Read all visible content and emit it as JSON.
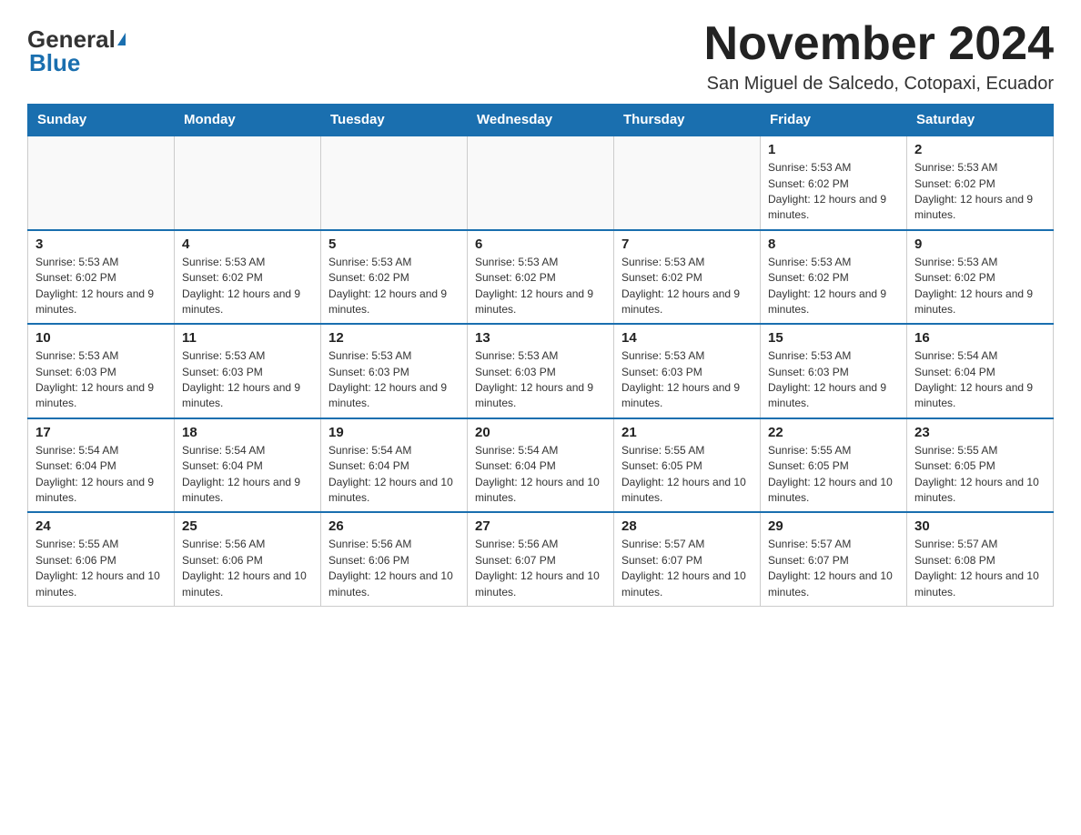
{
  "logo": {
    "general": "General",
    "blue": "Blue"
  },
  "title": "November 2024",
  "subtitle": "San Miguel de Salcedo, Cotopaxi, Ecuador",
  "weekdays": [
    "Sunday",
    "Monday",
    "Tuesday",
    "Wednesday",
    "Thursday",
    "Friday",
    "Saturday"
  ],
  "weeks": [
    [
      {
        "day": "",
        "info": ""
      },
      {
        "day": "",
        "info": ""
      },
      {
        "day": "",
        "info": ""
      },
      {
        "day": "",
        "info": ""
      },
      {
        "day": "",
        "info": ""
      },
      {
        "day": "1",
        "info": "Sunrise: 5:53 AM\nSunset: 6:02 PM\nDaylight: 12 hours and 9 minutes."
      },
      {
        "day": "2",
        "info": "Sunrise: 5:53 AM\nSunset: 6:02 PM\nDaylight: 12 hours and 9 minutes."
      }
    ],
    [
      {
        "day": "3",
        "info": "Sunrise: 5:53 AM\nSunset: 6:02 PM\nDaylight: 12 hours and 9 minutes."
      },
      {
        "day": "4",
        "info": "Sunrise: 5:53 AM\nSunset: 6:02 PM\nDaylight: 12 hours and 9 minutes."
      },
      {
        "day": "5",
        "info": "Sunrise: 5:53 AM\nSunset: 6:02 PM\nDaylight: 12 hours and 9 minutes."
      },
      {
        "day": "6",
        "info": "Sunrise: 5:53 AM\nSunset: 6:02 PM\nDaylight: 12 hours and 9 minutes."
      },
      {
        "day": "7",
        "info": "Sunrise: 5:53 AM\nSunset: 6:02 PM\nDaylight: 12 hours and 9 minutes."
      },
      {
        "day": "8",
        "info": "Sunrise: 5:53 AM\nSunset: 6:02 PM\nDaylight: 12 hours and 9 minutes."
      },
      {
        "day": "9",
        "info": "Sunrise: 5:53 AM\nSunset: 6:02 PM\nDaylight: 12 hours and 9 minutes."
      }
    ],
    [
      {
        "day": "10",
        "info": "Sunrise: 5:53 AM\nSunset: 6:03 PM\nDaylight: 12 hours and 9 minutes."
      },
      {
        "day": "11",
        "info": "Sunrise: 5:53 AM\nSunset: 6:03 PM\nDaylight: 12 hours and 9 minutes."
      },
      {
        "day": "12",
        "info": "Sunrise: 5:53 AM\nSunset: 6:03 PM\nDaylight: 12 hours and 9 minutes."
      },
      {
        "day": "13",
        "info": "Sunrise: 5:53 AM\nSunset: 6:03 PM\nDaylight: 12 hours and 9 minutes."
      },
      {
        "day": "14",
        "info": "Sunrise: 5:53 AM\nSunset: 6:03 PM\nDaylight: 12 hours and 9 minutes."
      },
      {
        "day": "15",
        "info": "Sunrise: 5:53 AM\nSunset: 6:03 PM\nDaylight: 12 hours and 9 minutes."
      },
      {
        "day": "16",
        "info": "Sunrise: 5:54 AM\nSunset: 6:04 PM\nDaylight: 12 hours and 9 minutes."
      }
    ],
    [
      {
        "day": "17",
        "info": "Sunrise: 5:54 AM\nSunset: 6:04 PM\nDaylight: 12 hours and 9 minutes."
      },
      {
        "day": "18",
        "info": "Sunrise: 5:54 AM\nSunset: 6:04 PM\nDaylight: 12 hours and 9 minutes."
      },
      {
        "day": "19",
        "info": "Sunrise: 5:54 AM\nSunset: 6:04 PM\nDaylight: 12 hours and 10 minutes."
      },
      {
        "day": "20",
        "info": "Sunrise: 5:54 AM\nSunset: 6:04 PM\nDaylight: 12 hours and 10 minutes."
      },
      {
        "day": "21",
        "info": "Sunrise: 5:55 AM\nSunset: 6:05 PM\nDaylight: 12 hours and 10 minutes."
      },
      {
        "day": "22",
        "info": "Sunrise: 5:55 AM\nSunset: 6:05 PM\nDaylight: 12 hours and 10 minutes."
      },
      {
        "day": "23",
        "info": "Sunrise: 5:55 AM\nSunset: 6:05 PM\nDaylight: 12 hours and 10 minutes."
      }
    ],
    [
      {
        "day": "24",
        "info": "Sunrise: 5:55 AM\nSunset: 6:06 PM\nDaylight: 12 hours and 10 minutes."
      },
      {
        "day": "25",
        "info": "Sunrise: 5:56 AM\nSunset: 6:06 PM\nDaylight: 12 hours and 10 minutes."
      },
      {
        "day": "26",
        "info": "Sunrise: 5:56 AM\nSunset: 6:06 PM\nDaylight: 12 hours and 10 minutes."
      },
      {
        "day": "27",
        "info": "Sunrise: 5:56 AM\nSunset: 6:07 PM\nDaylight: 12 hours and 10 minutes."
      },
      {
        "day": "28",
        "info": "Sunrise: 5:57 AM\nSunset: 6:07 PM\nDaylight: 12 hours and 10 minutes."
      },
      {
        "day": "29",
        "info": "Sunrise: 5:57 AM\nSunset: 6:07 PM\nDaylight: 12 hours and 10 minutes."
      },
      {
        "day": "30",
        "info": "Sunrise: 5:57 AM\nSunset: 6:08 PM\nDaylight: 12 hours and 10 minutes."
      }
    ]
  ]
}
